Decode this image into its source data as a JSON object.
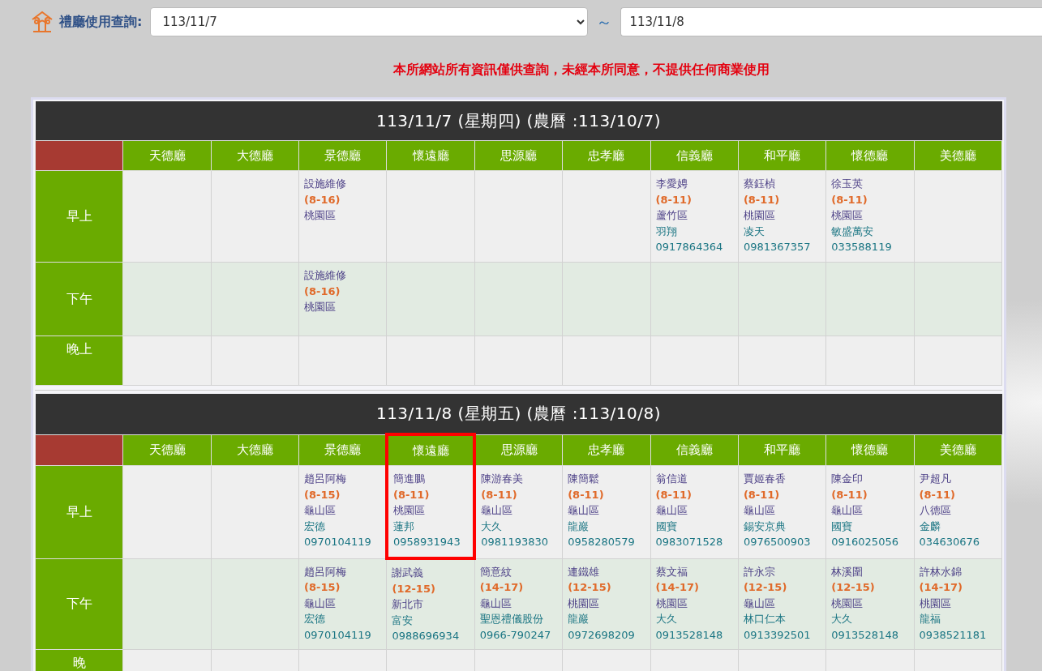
{
  "query": {
    "label": "禮廳使用查詢:",
    "start_date": "113/11/7",
    "separator": "～",
    "end_date": "113/11/8"
  },
  "notice": "本所網站所有資訊僅供查詢，未經本所同意，不提供任何商業使用",
  "days": [
    {
      "title": "113/11/7 (星期四) (農曆 :113/10/7)",
      "halls": [
        {
          "name": "天德廳",
          "highlighted": false
        },
        {
          "name": "大德廳",
          "highlighted": false
        },
        {
          "name": "景德廳",
          "highlighted": false
        },
        {
          "name": "懷遠廳",
          "highlighted": false
        },
        {
          "name": "思源廳",
          "highlighted": false
        },
        {
          "name": "忠孝廳",
          "highlighted": false
        },
        {
          "name": "信義廳",
          "highlighted": false
        },
        {
          "name": "和平廳",
          "highlighted": false
        },
        {
          "name": "懷德廳",
          "highlighted": false
        },
        {
          "name": "美德廳",
          "highlighted": false
        }
      ],
      "periods": [
        {
          "label": "早上",
          "cells": [
            {
              "kind": "empty"
            },
            {
              "kind": "empty"
            },
            {
              "kind": "maintenance",
              "name": "設施維修",
              "time": "(8-16)",
              "area": "桃園區"
            },
            {
              "kind": "empty"
            },
            {
              "kind": "empty"
            },
            {
              "kind": "empty"
            },
            {
              "kind": "booking",
              "name": "李愛娉",
              "time": "(8-11)",
              "area": "蘆竹區",
              "company": "羽翔",
              "phone": "0917864364"
            },
            {
              "kind": "booking",
              "name": "蔡鈺楨",
              "time": "(8-11)",
              "area": "桃園區",
              "company": "凌天",
              "phone": "0981367357"
            },
            {
              "kind": "booking",
              "name": "徐玉英",
              "time": "(8-11)",
              "area": "桃園區",
              "company": "敏盛萬安",
              "phone": "033588119"
            },
            {
              "kind": "empty"
            }
          ]
        },
        {
          "label": "下午",
          "cells": [
            {
              "kind": "empty"
            },
            {
              "kind": "empty"
            },
            {
              "kind": "maintenance",
              "name": "設施維修",
              "time": "(8-16)",
              "area": "桃園區"
            },
            {
              "kind": "empty"
            },
            {
              "kind": "empty"
            },
            {
              "kind": "empty"
            },
            {
              "kind": "empty"
            },
            {
              "kind": "empty"
            },
            {
              "kind": "empty"
            },
            {
              "kind": "empty"
            }
          ]
        },
        {
          "label": "晚上",
          "cells": [
            {
              "kind": "empty"
            },
            {
              "kind": "empty"
            },
            {
              "kind": "empty"
            },
            {
              "kind": "empty"
            },
            {
              "kind": "empty"
            },
            {
              "kind": "empty"
            },
            {
              "kind": "empty"
            },
            {
              "kind": "empty"
            },
            {
              "kind": "empty"
            },
            {
              "kind": "empty"
            }
          ]
        }
      ]
    },
    {
      "title": "113/11/8 (星期五) (農曆 :113/10/8)",
      "halls": [
        {
          "name": "天德廳",
          "highlighted": false
        },
        {
          "name": "大德廳",
          "highlighted": false
        },
        {
          "name": "景德廳",
          "highlighted": false
        },
        {
          "name": "懷遠廳",
          "highlighted": true
        },
        {
          "name": "思源廳",
          "highlighted": false
        },
        {
          "name": "忠孝廳",
          "highlighted": false
        },
        {
          "name": "信義廳",
          "highlighted": false
        },
        {
          "name": "和平廳",
          "highlighted": false
        },
        {
          "name": "懷德廳",
          "highlighted": false
        },
        {
          "name": "美德廳",
          "highlighted": false
        }
      ],
      "periods": [
        {
          "label": "早上",
          "cells": [
            {
              "kind": "empty"
            },
            {
              "kind": "empty"
            },
            {
              "kind": "booking",
              "name": "趙呂阿梅",
              "time": "(8-15)",
              "area": "龜山區",
              "company": "宏德",
              "phone": "0970104119"
            },
            {
              "kind": "booking",
              "name": "簡進鵬",
              "time": "(8-11)",
              "area": "桃園區",
              "company": "蓮邦",
              "phone": "0958931943"
            },
            {
              "kind": "booking",
              "name": "陳游春美",
              "time": "(8-11)",
              "area": "龜山區",
              "company": "大久",
              "phone": "0981193830"
            },
            {
              "kind": "booking",
              "name": "陳簡鬆",
              "time": "(8-11)",
              "area": "龜山區",
              "company": "龍巖",
              "phone": "0958280579"
            },
            {
              "kind": "booking",
              "name": "翁信道",
              "time": "(8-11)",
              "area": "龜山區",
              "company": "國寶",
              "phone": "0983071528"
            },
            {
              "kind": "booking",
              "name": "賈姬春香",
              "time": "(8-11)",
              "area": "龜山區",
              "company": "錫安京典",
              "phone": "0976500903"
            },
            {
              "kind": "booking",
              "name": "陳金印",
              "time": "(8-11)",
              "area": "龜山區",
              "company": "國寶",
              "phone": "0916025056"
            },
            {
              "kind": "booking",
              "name": "尹超凡",
              "time": "(8-11)",
              "area": "八德區",
              "company": "金麟",
              "phone": "034630676"
            }
          ]
        },
        {
          "label": "下午",
          "cells": [
            {
              "kind": "empty"
            },
            {
              "kind": "empty"
            },
            {
              "kind": "booking",
              "name": "趙呂阿梅",
              "time": "(8-15)",
              "area": "龜山區",
              "company": "宏德",
              "phone": "0970104119"
            },
            {
              "kind": "booking",
              "name": "謝武義",
              "time": "(12-15)",
              "area": "新北市",
              "company": "富安",
              "phone": "0988696934"
            },
            {
              "kind": "booking",
              "name": "簡意紋",
              "time": "(14-17)",
              "area": "龜山區",
              "company": "聖恩禮儀股份",
              "phone": "0966-790247"
            },
            {
              "kind": "booking",
              "name": "連鐵雄",
              "time": "(12-15)",
              "area": "桃園區",
              "company": "龍巖",
              "phone": "0972698209"
            },
            {
              "kind": "booking",
              "name": "蔡文福",
              "time": "(14-17)",
              "area": "桃園區",
              "company": "大久",
              "phone": "0913528148"
            },
            {
              "kind": "booking",
              "name": "許永宗",
              "time": "(12-15)",
              "area": "龜山區",
              "company": "林口仁本",
              "phone": "0913392501"
            },
            {
              "kind": "booking",
              "name": "林溪圍",
              "time": "(12-15)",
              "area": "桃園區",
              "company": "大久",
              "phone": "0913528148"
            },
            {
              "kind": "booking",
              "name": "許林水錦",
              "time": "(14-17)",
              "area": "桃園區",
              "company": "龍福",
              "phone": "0938521181"
            }
          ]
        },
        {
          "label": "晚",
          "cells": [
            {
              "kind": "empty"
            },
            {
              "kind": "empty"
            },
            {
              "kind": "empty"
            },
            {
              "kind": "empty"
            },
            {
              "kind": "empty"
            },
            {
              "kind": "empty"
            },
            {
              "kind": "empty"
            },
            {
              "kind": "empty"
            },
            {
              "kind": "empty"
            },
            {
              "kind": "empty"
            }
          ]
        }
      ]
    }
  ]
}
